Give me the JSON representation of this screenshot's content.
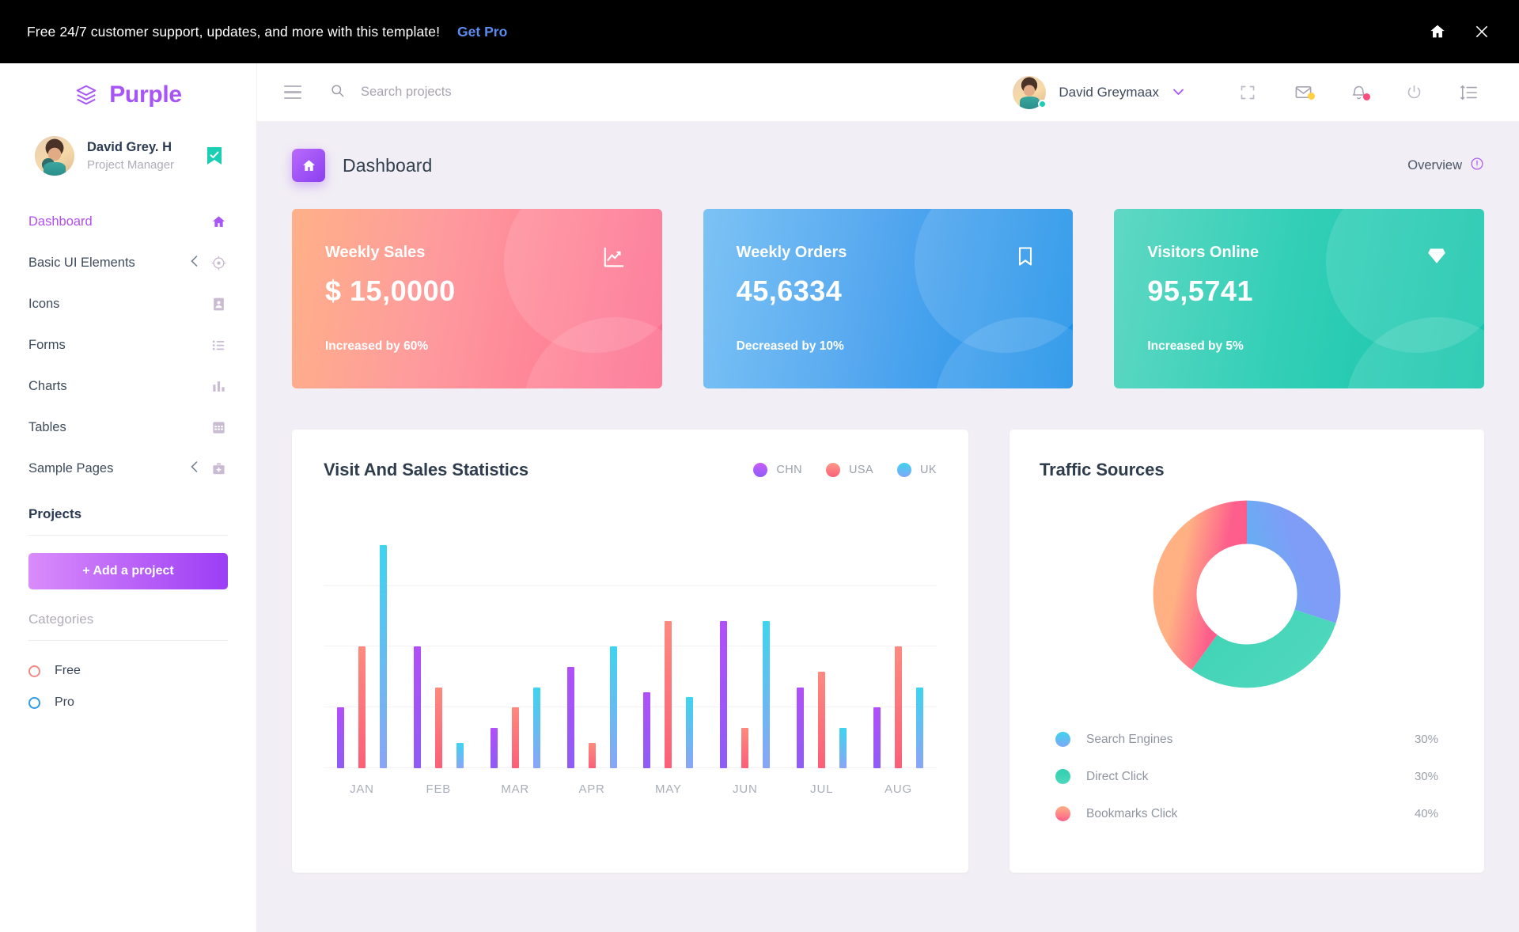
{
  "banner": {
    "text": "Free 24/7 customer support, updates, and more with this template!",
    "cta": "Get Pro",
    "home_icon": "home-icon",
    "close_icon": "close-icon"
  },
  "sidebar": {
    "brand": {
      "name": "Purple",
      "logo_icon": "layers-icon",
      "color": "#a855f7"
    },
    "profile": {
      "name": "David Grey. H",
      "role": "Project Manager",
      "badge_icon": "verified-bookmark-icon",
      "badge_color": "#1bcfb4"
    },
    "nav": [
      {
        "label": "Dashboard",
        "icon": "home-icon",
        "active": true,
        "expandable": false
      },
      {
        "label": "Basic UI Elements",
        "icon": "crosshair-icon",
        "active": false,
        "expandable": true
      },
      {
        "label": "Icons",
        "icon": "contact-icon",
        "active": false,
        "expandable": false
      },
      {
        "label": "Forms",
        "icon": "list-icon",
        "active": false,
        "expandable": false
      },
      {
        "label": "Charts",
        "icon": "bar-chart-icon",
        "active": false,
        "expandable": false
      },
      {
        "label": "Tables",
        "icon": "grid-icon",
        "active": false,
        "expandable": false
      },
      {
        "label": "Sample Pages",
        "icon": "medkit-icon",
        "active": false,
        "expandable": true
      }
    ],
    "projects_title": "Projects",
    "add_project_label": "+ Add a project",
    "categories_title": "Categories",
    "categories": [
      {
        "label": "Free",
        "color": "#f08a84"
      },
      {
        "label": "Pro",
        "color": "#2f9ae8"
      }
    ]
  },
  "topbar": {
    "menu_icon": "hamburger-icon",
    "search_icon": "search-icon",
    "search_value": "",
    "search_placeholder": "Search projects",
    "user_name": "David Greymaax",
    "caret_icon": "chevron-down-icon",
    "icons": [
      {
        "name": "fullscreen-icon",
        "badge": null
      },
      {
        "name": "mail-icon",
        "badge": "#ffcf44"
      },
      {
        "name": "bell-icon",
        "badge": "#fc4d7d"
      },
      {
        "name": "power-icon",
        "badge": null
      },
      {
        "name": "list-format-icon",
        "badge": null
      }
    ]
  },
  "page": {
    "title": "Dashboard",
    "icon": "home-icon",
    "overview_label": "Overview",
    "overview_icon": "info-circle-icon"
  },
  "stat_cards": [
    {
      "title": "Weekly Sales",
      "value": "$ 15,0000",
      "delta": "Increased by 60%",
      "icon": "line-chart-icon",
      "theme": "red"
    },
    {
      "title": "Weekly Orders",
      "value": "45,6334",
      "delta": "Decreased by 10%",
      "icon": "bookmark-icon",
      "theme": "blue"
    },
    {
      "title": "Visitors Online",
      "value": "95,5741",
      "delta": "Increased by 5%",
      "icon": "diamond-icon",
      "theme": "green"
    }
  ],
  "chart_data": [
    {
      "type": "bar",
      "title": "Visit And Sales Statistics",
      "categories": [
        "JAN",
        "FEB",
        "MAR",
        "APR",
        "MAY",
        "JUN",
        "JUL",
        "AUG"
      ],
      "series": [
        {
          "name": "CHN",
          "color": "#b14ff8",
          "values": [
            24,
            48,
            16,
            40,
            30,
            58,
            32,
            24
          ]
        },
        {
          "name": "USA",
          "color": "#fb5f78",
          "values": [
            48,
            32,
            24,
            10,
            58,
            16,
            38,
            48
          ]
        },
        {
          "name": "UK",
          "color": "#59b7f2",
          "values": [
            88,
            10,
            32,
            48,
            28,
            58,
            16,
            32
          ]
        }
      ],
      "ylim": [
        0,
        100
      ],
      "grid": true,
      "gridlines": [
        24,
        48,
        72
      ],
      "xlabel": "",
      "ylabel": "",
      "legend_position": "top-right"
    },
    {
      "type": "pie",
      "title": "Traffic Sources",
      "donut": true,
      "labels": [
        "Search Engines",
        "Direct Click",
        "Bookmarks Click"
      ],
      "values": [
        30,
        30,
        40
      ],
      "display_values": [
        "30%",
        "30%",
        "40%"
      ],
      "colors": [
        "#3fd0ef",
        "#30cfb0",
        "#fd5f8c"
      ],
      "legend_position": "bottom"
    }
  ]
}
